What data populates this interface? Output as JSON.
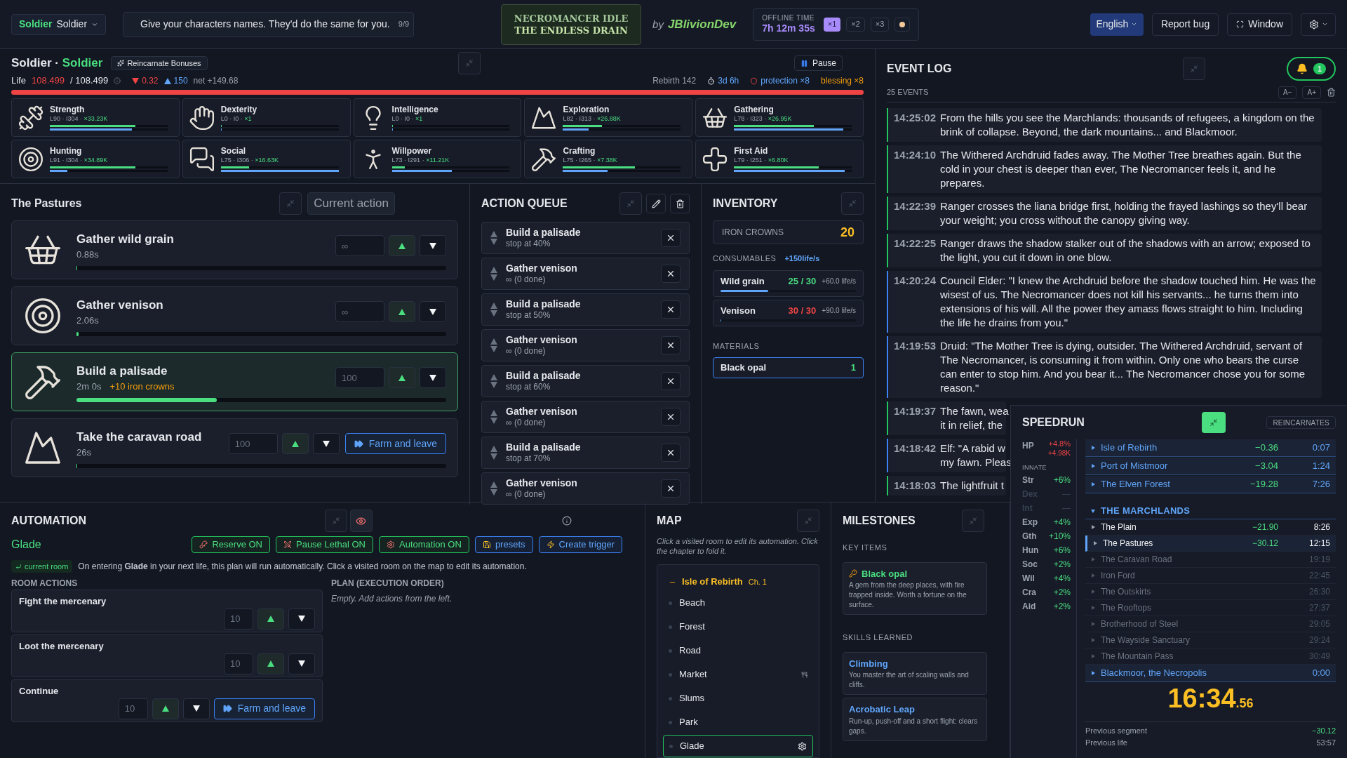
{
  "top_bar": {
    "character": {
      "class": "Soldier",
      "name": "Soldier"
    },
    "tip": {
      "text": "Give your characters names. They'd do the same for you.",
      "count": "9/9"
    },
    "logo": {
      "title": "NECROMANCER IDLE",
      "subtitle": "THE ENDLESS DRAIN"
    },
    "credit": {
      "by": "by",
      "author": "JBlivionDev"
    },
    "offline_time": {
      "label": "OFFLINE TIME",
      "value": "7h 12m 35s",
      "speeds": [
        {
          "label": "×1",
          "selected": true
        },
        {
          "label": "×2",
          "selected": false
        },
        {
          "label": "×3",
          "selected": false
        }
      ]
    },
    "language": "English",
    "report_bug": "Report bug",
    "window": "Window"
  },
  "character": {
    "class": "Soldier",
    "separator": "·",
    "name": "Soldier",
    "bonus_button": "Reincarnate Bonuses",
    "pause": "Pause",
    "life": {
      "label": "Life",
      "current": "108.499",
      "max": "/ 108.499",
      "loss": "0.32",
      "gain": "150",
      "net": "net +149.68",
      "level": 1
    },
    "rebirth": "Rebirth 142",
    "age": "3d 6h",
    "protection": "protection ×8",
    "blessing": "blessing ×8"
  },
  "skills": [
    {
      "name": "Strength",
      "stats": "L90 · I304 · ",
      "mult": "×33.23K",
      "xp": {
        "level": 0.73
      },
      "progress": {
        "level": 0.7
      }
    },
    {
      "name": "Dexterity",
      "stats": "L0 · I0 · ",
      "mult": "×1",
      "xp": {
        "level": 0
      },
      "progress": {
        "level": 0
      }
    },
    {
      "name": "Intelligence",
      "stats": "L0 · I0 · ",
      "mult": "×1",
      "xp": {
        "level": 0
      },
      "progress": {
        "level": 0
      }
    },
    {
      "name": "Exploration",
      "stats": "L82 · I313 · ",
      "mult": "×26.88K",
      "xp": {
        "level": 0.33
      },
      "progress": {
        "level": 0.22
      }
    },
    {
      "name": "Gathering",
      "stats": "L78 · I323 · ",
      "mult": "×26.95K",
      "xp": {
        "level": 0.68
      },
      "progress": {
        "level": 0.93
      }
    },
    {
      "name": "Hunting",
      "stats": "L91 · I304 · ",
      "mult": "×34.89K",
      "xp": {
        "level": 0.73
      },
      "progress": {
        "level": 0.15
      }
    },
    {
      "name": "Social",
      "stats": "L75 · I306 · ",
      "mult": "×16.63K",
      "xp": {
        "level": 0.24
      },
      "progress": {
        "level": 1
      }
    },
    {
      "name": "Willpower",
      "stats": "L73 · I291 · ",
      "mult": "×11.21K",
      "xp": {
        "level": 0.11
      },
      "progress": {
        "level": 0.51
      }
    },
    {
      "name": "Crafting",
      "stats": "L75 · I265 · ",
      "mult": "×7.38K",
      "xp": {
        "level": 0.61
      },
      "progress": {
        "level": 0.38
      }
    },
    {
      "name": "First Aid",
      "stats": "L79 · I251 · ",
      "mult": "×6.80K",
      "xp": {
        "level": 0.72
      },
      "progress": {
        "level": 0.94
      }
    }
  ],
  "location": {
    "title": "The Pastures",
    "current_action": "Current action",
    "actions": [
      {
        "name": "Gather wild grain",
        "time": "0.88s",
        "placeholder": "∞",
        "level": 0,
        "selected": false
      },
      {
        "name": "Gather venison",
        "time": "2.06s",
        "placeholder": "∞",
        "level": 0.005,
        "selected": false
      },
      {
        "name": "Build a palisade",
        "time": "2m 0s",
        "reward": "+10 iron crowns",
        "placeholder": "100",
        "level": 0.38,
        "selected": true
      },
      {
        "name": "Take the caravan road",
        "time": "26s",
        "placeholder": "100",
        "level": 0,
        "selected": false,
        "farm": "Farm and leave"
      }
    ]
  },
  "action_queue": {
    "title": "ACTION QUEUE",
    "items": [
      {
        "name": "Build a palisade",
        "detail": "stop at 40%"
      },
      {
        "name": "Gather venison",
        "detail": "∞ (0 done)"
      },
      {
        "name": "Build a palisade",
        "detail": "stop at 50%"
      },
      {
        "name": "Gather venison",
        "detail": "∞ (0 done)"
      },
      {
        "name": "Build a palisade",
        "detail": "stop at 60%"
      },
      {
        "name": "Gather venison",
        "detail": "∞ (0 done)"
      },
      {
        "name": "Build a palisade",
        "detail": "stop at 70%"
      },
      {
        "name": "Gather venison",
        "detail": "∞ (0 done)"
      }
    ]
  },
  "inventory": {
    "title": "INVENTORY",
    "currency": {
      "label": "IRON CROWNS",
      "value": "20"
    },
    "consumables": {
      "label": "CONSUMABLES",
      "rate": "+150life/s",
      "items": [
        {
          "name": "Wild grain",
          "count": "25 / 30",
          "full": false,
          "rate": "+60.0 life/s",
          "level": 0.35
        },
        {
          "name": "Venison",
          "count": "30 / 30",
          "full": true,
          "rate": "+90.0 life/s",
          "level": 0
        }
      ]
    },
    "materials": {
      "label": "MATERIALS",
      "items": [
        {
          "name": "Black opal",
          "count": "1"
        }
      ]
    }
  },
  "event_log": {
    "title": "EVENT LOG",
    "count": "25 EVENTS",
    "notifications": "1",
    "font_smaller": "A−",
    "font_larger": "A+",
    "entries": [
      {
        "kind": "full",
        "time": "14:25:02",
        "text": "From the hills you see the Marchlands: thousands of refugees, a kingdom on the brink of collapse. Beyond, the dark mountains... and Blackmoor.",
        "color": "#22c55e"
      },
      {
        "kind": "full",
        "time": "14:24:10",
        "text": "The Withered Archdruid fades away. The Mother Tree breathes again. But the cold in your chest is deeper than ever, The Necromancer feels it, and he prepares.",
        "color": "#22c55e"
      },
      {
        "kind": "full",
        "time": "14:22:39",
        "text": "Ranger crosses the liana bridge first, holding the frayed lashings so they'll bear your weight; you cross without the canopy giving way.",
        "color": "#22c55e"
      },
      {
        "kind": "full",
        "time": "14:22:25",
        "text": "Ranger draws the shadow stalker out of the shadows with an arrow; exposed to the light, you cut it down in one blow.",
        "color": "#22c55e"
      },
      {
        "kind": "full",
        "time": "14:20:24",
        "text": "Council Elder: \"I knew the Archdruid before the shadow touched him. He was the wisest of us. The Necromancer does not kill his servants... he turns them into extensions of his will. All the power they amass flows straight to him. Including the life he drains from you.\"",
        "color": "#3b82f6"
      },
      {
        "kind": "full",
        "time": "14:19:53",
        "text": "Druid: \"The Mother Tree is dying, outsider. The Withered Archdruid, servant of The Necromancer, is consuming it from within. Only one who bears the curse can enter to stop him. And you bear it... The Necromancer chose you for some reason.\"",
        "color": "#3b82f6"
      },
      {
        "kind": "clipped",
        "time": "14:19:37",
        "lines": [
          "The fawn, wea",
          "it in relief, the"
        ],
        "color": "#22c55e"
      },
      {
        "kind": "clipped",
        "time": "14:18:42",
        "lines": [
          "Elf: \"A rabid w",
          "my fawn. Pleas"
        ],
        "color": "#3b82f6"
      },
      {
        "kind": "clipped",
        "time": "14:18:03",
        "lines": [
          "The lightfruit t"
        ],
        "color": "#22c55e"
      }
    ]
  },
  "automation": {
    "title": "AUTOMATION",
    "room": "Glade",
    "buttons": [
      {
        "label": "Reserve ON",
        "kind": "toggle"
      },
      {
        "label": "Pause Lethal ON",
        "kind": "toggle"
      },
      {
        "label": "Automation ON",
        "kind": "toggle"
      },
      {
        "label": "presets",
        "kind": "action"
      },
      {
        "label": "Create trigger",
        "kind": "action"
      }
    ],
    "current_room": "current room",
    "description": "On entering **Glade** in your next life, this plan will run automatically. Click a visited room on the map to edit its automation.",
    "room_actions": {
      "label": "ROOM ACTIONS",
      "items": [
        {
          "name": "Fight the mercenary",
          "placeholder": "10"
        },
        {
          "name": "Loot the mercenary",
          "placeholder": "10"
        },
        {
          "name": "Continue",
          "placeholder": "10",
          "farm": "Farm and leave"
        }
      ]
    },
    "plan": {
      "label": "PLAN (EXECUTION ORDER)",
      "empty": "Empty. Add actions from the left."
    }
  },
  "map": {
    "title": "MAP",
    "hint": "Click a visited room to edit its automation. Click the chapter to fold it.",
    "chapter": {
      "name": "Isle of Rebirth",
      "number": "Ch. 1",
      "expanded": true,
      "rooms": [
        {
          "name": "Beach",
          "selected": false,
          "shop": false
        },
        {
          "name": "Forest",
          "selected": false,
          "shop": false
        },
        {
          "name": "Road",
          "selected": false,
          "shop": false
        },
        {
          "name": "Market",
          "selected": false,
          "shop": true
        },
        {
          "name": "Slums",
          "selected": false,
          "shop": false
        },
        {
          "name": "Park",
          "selected": false,
          "shop": false
        },
        {
          "name": "Glade",
          "selected": true,
          "shop": false
        }
      ]
    }
  },
  "milestones": {
    "title": "MILESTONES",
    "key_items": {
      "label": "KEY ITEMS",
      "items": [
        {
          "name": "Black opal",
          "description": "A gem from the deep places, with fire trapped inside. Worth a fortune on the surface."
        }
      ]
    },
    "skills": {
      "label": "SKILLS LEARNED",
      "items": [
        {
          "name": "Climbing",
          "description": "You master the art of scaling walls and cliffs."
        },
        {
          "name": "Acrobatic Leap",
          "description": "Run-up, push-off and a short flight: clears gaps."
        }
      ]
    }
  },
  "speedrun": {
    "title": "SPEEDRUN",
    "reincarnates": "REINCARNATES",
    "hp": {
      "label": "HP",
      "percent": "+4.8%",
      "amount": "+4.98K"
    },
    "innate_label": "INNATE",
    "innate": [
      {
        "label": "Str",
        "value": "+6%",
        "active": true
      },
      {
        "label": "Dex",
        "value": "—",
        "active": false
      },
      {
        "label": "Int",
        "value": "—",
        "active": false
      },
      {
        "label": "Exp",
        "value": "+4%",
        "active": true
      },
      {
        "label": "Gth",
        "value": "+10%",
        "active": true
      },
      {
        "label": "Hun",
        "value": "+6%",
        "active": true
      },
      {
        "label": "Soc",
        "value": "+2%",
        "active": true
      },
      {
        "label": "Wil",
        "value": "+4%",
        "active": true
      },
      {
        "label": "Cra",
        "value": "+2%",
        "active": true
      },
      {
        "label": "Aid",
        "value": "+2%",
        "active": true
      }
    ],
    "splits": [
      {
        "kind": "chapter",
        "name": "Isle of Rebirth",
        "delta": "−0.36",
        "time": "0:07"
      },
      {
        "kind": "chapter",
        "name": "Port of Mistmoor",
        "delta": "−3.04",
        "time": "1:24"
      },
      {
        "kind": "chapter",
        "name": "The Elven Forest",
        "delta": "−19.28",
        "time": "7:26"
      },
      {
        "kind": "section",
        "name": "THE MARCHLANDS",
        "expanded": true
      },
      {
        "kind": "room",
        "name": "The Plain",
        "delta": "−21.90",
        "time": "8:26",
        "done": true,
        "selected": false
      },
      {
        "kind": "room",
        "name": "The Pastures",
        "delta": "−30.12",
        "time": "12:15",
        "done": true,
        "selected": true
      },
      {
        "kind": "room",
        "name": "The Caravan Road",
        "time": "19:19",
        "done": false,
        "selected": false
      },
      {
        "kind": "room",
        "name": "Iron Ford",
        "time": "22:45",
        "done": false,
        "selected": false
      },
      {
        "kind": "room",
        "name": "The Outskirts",
        "time": "26:30",
        "done": false,
        "selected": false
      },
      {
        "kind": "room",
        "name": "The Rooftops",
        "time": "27:37",
        "done": false,
        "selected": false
      },
      {
        "kind": "room",
        "name": "Brotherhood of Steel",
        "time": "29:05",
        "done": false,
        "selected": false
      },
      {
        "kind": "room",
        "name": "The Wayside Sanctuary",
        "time": "29:24",
        "done": false,
        "selected": false
      },
      {
        "kind": "room",
        "name": "The Mountain Pass",
        "time": "30:49",
        "done": false,
        "selected": false
      },
      {
        "kind": "chapter",
        "name": "Blackmoor, the Necropolis",
        "time": "0:00"
      }
    ],
    "timer": {
      "main": "16:34",
      "fraction": ".56"
    },
    "previous_segment": {
      "label": "Previous segment",
      "value": "−30.12"
    },
    "previous_life": {
      "label": "Previous life",
      "value": "53:57"
    }
  }
}
